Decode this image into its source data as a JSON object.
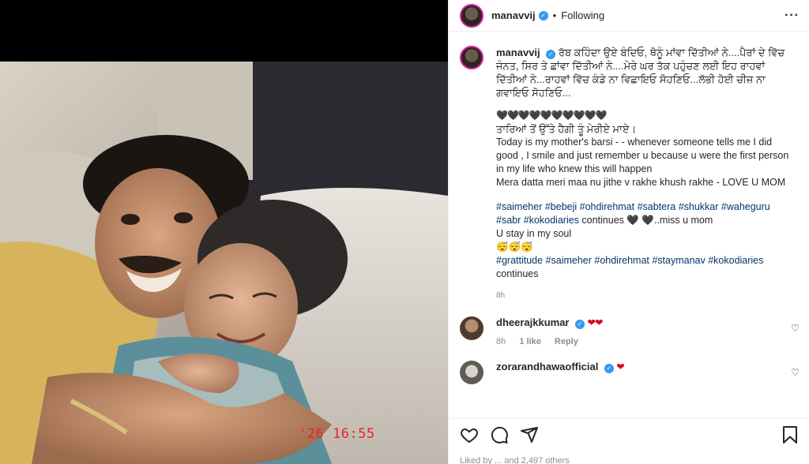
{
  "post": {
    "username": "manavvij",
    "follow_status": "Following",
    "dot": "•",
    "verified_glyph": "✓",
    "more_glyph": "···",
    "photo_timestamp": "'26 16:55"
  },
  "caption": {
    "username": "manavvij",
    "punjabi_text": "ਰੱਬ ਕਹਿੰਦਾ ਉਏ ਬੰਦਿਓ, ਥੋਨੂੰ ਮਾਂਵਾ ਦਿੱਤੀਆਂ ਨੇ....ਪੈਰਾਂ ਦੇ ਵਿੱਚ ਜੰਨਤ, ਸਿਰ ਤੇ ਛਾਂਵਾ ਦਿੱਤੀਆਂ ਨੇ....ਮੇਰੇ ਘਰ ਤੱਕ ਪਹੁੰਚਣ ਲਈ ਇਹ ਰਾਹਵਾਂ ਦਿੱਤੀਆਂ ਨੇ...ਰਾਹਵਾਂ ਵਿੱਚ ਕੰਡੇ ਨਾ ਵਿਛਾਇਓ ਸੋਹਣਿਓ...ਲੱਭੀ ਹੋਈ ਚੀਜ਼ ਨਾ ਗਵਾਇਓ ਸੋਹਣਿਓ...",
    "hearts": "🖤🖤🖤🖤🖤🖤🖤🖤🖤🖤",
    "punjabi_line2": "ਤਾਰਿਆਂ ਤੋਂ ਉੱਤੇ ਹੈਗੀ ਤੂੰ ਮੇਰੀਏ ਮਾਏ।",
    "english_1": "Today is my mother's barsi - - whenever someone tells me I did good , I smile and just remember u because u were the first person in my life who knew this will happen",
    "english_2": "Mera datta meri maa nu jithe v rakhe khush rakhe - LOVE U MOM",
    "hashtags_1": "#saimeher #bebeji #ohdirehmat #sabtera #shukkar #waheguru #sabr #kokodiaries",
    "hashtags_1_tail": " continues 🖤 🖤..miss u mom",
    "soul_line": "U stay in my soul",
    "emojis": "😴😴😴",
    "hashtags_2": "#grattitude #saimeher #ohdirehmat #staymanav #kokodiaries",
    "hashtags_2_tail": "continues",
    "time": "8h"
  },
  "comments": [
    {
      "username": "dheerajkkumar",
      "text": "❤❤",
      "time": "8h",
      "likes": "1 like",
      "reply": "Reply"
    },
    {
      "username": "zorarandhawaofficial",
      "text": "❤",
      "time": "",
      "likes": "",
      "reply": ""
    }
  ],
  "likes_line": "Liked by ... and 2,497 others",
  "icons": {
    "like": "heart-icon",
    "comment": "comment-icon",
    "share": "share-icon",
    "save": "bookmark-icon"
  },
  "colors": {
    "link": "#00376b",
    "verified": "#3897f0",
    "timestamp": "#e8242a"
  }
}
